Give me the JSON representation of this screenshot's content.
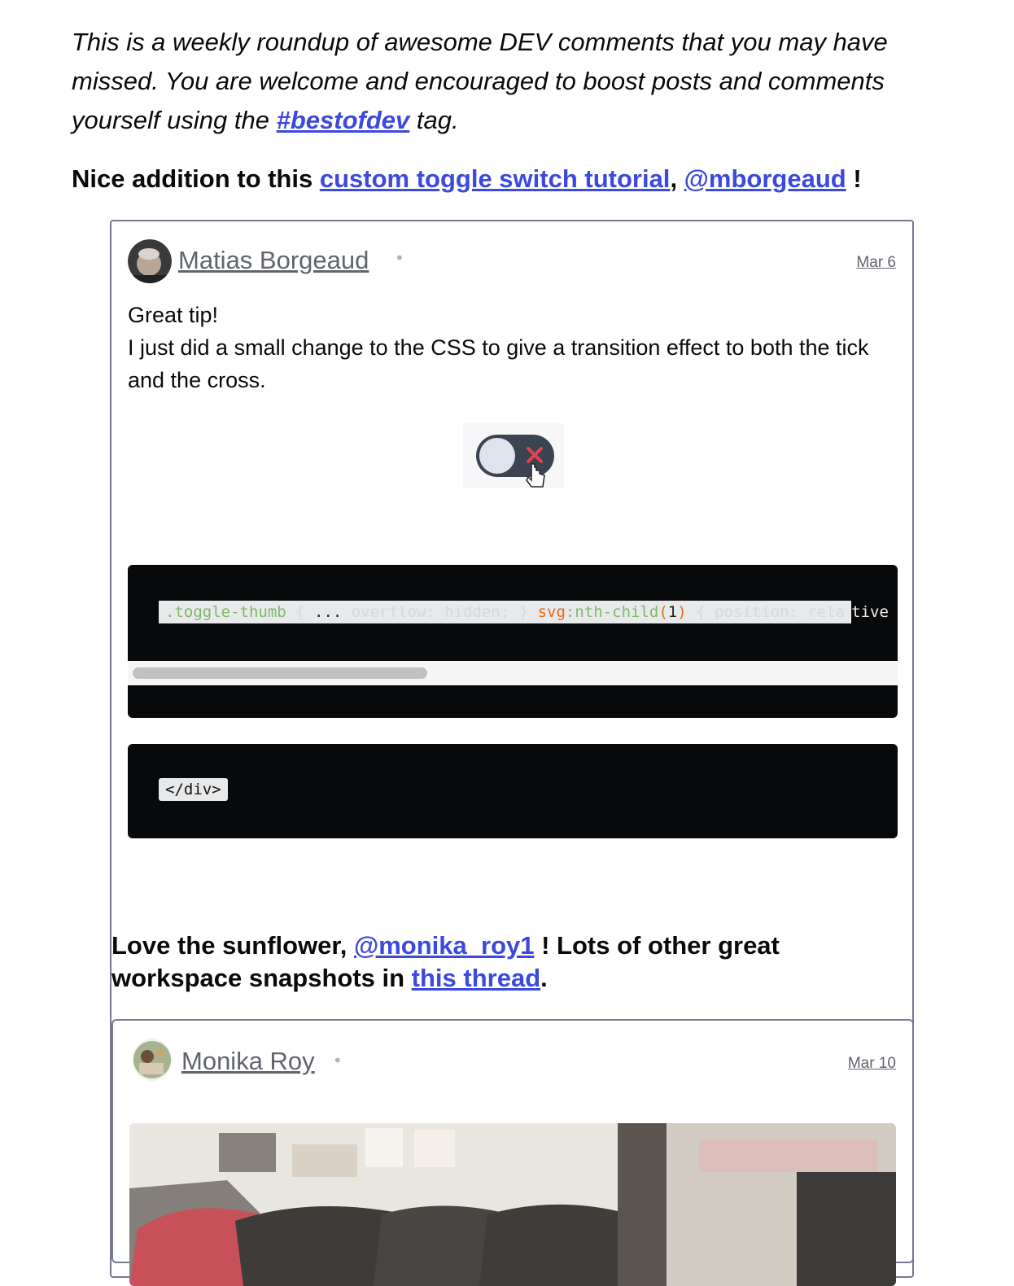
{
  "intro": {
    "text_before": "This is a weekly roundup of awesome DEV comments that you may have missed. You are welcome and encouraged to boost posts and comments yourself using the ",
    "tag_link": "#bestofdev",
    "text_after": " tag."
  },
  "section1": {
    "prefix": "Nice addition to this ",
    "link1": "custom toggle switch tutorial",
    "sep": ", ",
    "link2": "@mborgeaud",
    "suffix": " !"
  },
  "comment1": {
    "author": "Matias Borgeaud",
    "dot": "•",
    "date": "Mar 6",
    "line1": "Great tip!",
    "line2": "I just did a small change to the CSS to give a transition effect to both the tick and the cross.",
    "code": {
      "selector": ".toggle-thumb",
      "brace_open": " { ",
      "ellipsis": "...",
      "faded1": " overflow: hidden; } ",
      "svg": "svg",
      "colon": ":",
      "pseudo": "nth-child",
      "paren_open": "(",
      "num": "1",
      "paren_close": ")",
      "faded2": " { position: rela",
      "tail": "tive"
    },
    "code2": "</div>"
  },
  "section2": {
    "prefix": "Love the sunflower, ",
    "link1": "@monika_roy1",
    "middle": " ! Lots of other great workspace snapshots in ",
    "link2": "this thread",
    "suffix": "."
  },
  "comment2": {
    "author": "Monika Roy",
    "dot": "•",
    "date": "Mar 10"
  },
  "colors": {
    "link": "#3b49df",
    "code_bg": "#08090a",
    "muted": "#60646d"
  }
}
